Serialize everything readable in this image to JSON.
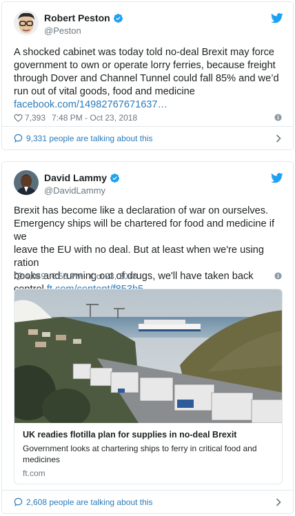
{
  "colors": {
    "link": "#2b7bb9",
    "muted": "#697882",
    "border": "#e1e8ed",
    "twitter_blue": "#1da1f2"
  },
  "tweets": [
    {
      "name": "Robert Peston",
      "handle": "@Peston",
      "text_lines": [
        "A shocked cabinet was today told no-deal Brexit may force",
        "government to own or operate lorry ferries, because freight",
        "through Dover and Channel Tunnel could fall 85% and we’d",
        "run out of vital goods, food and medicine"
      ],
      "link": "facebook.com/14982767671637…",
      "likes": "7,393",
      "timestamp": "7:48 PM - Oct 23, 2018",
      "talking": "9,331 people are talking about this",
      "icons": {
        "verified": "verified-badge-icon",
        "bird": "twitter-bird-icon",
        "heart": "heart-icon",
        "info": "info-icon",
        "bubble": "speech-bubble-icon",
        "chevron": "chevron-right-icon"
      }
    },
    {
      "name": "David Lammy",
      "handle": "@DavidLammy",
      "text_lines": [
        "Brexit has become like a declaration of war on ourselves.",
        "Emergency ships will be chartered for food and medicine if we",
        "leave the EU with no deal. But at least when we're using ration",
        "books and running out of drugs, we'll have taken back"
      ],
      "last_line_text": "control.",
      "link": "ft.com/content/f853b5…",
      "likes": "4,049",
      "timestamp": "6:53 PM - Oct 23, 2018",
      "card": {
        "title": "UK readies flotilla plan for supplies in no-deal Brexit",
        "description": "Government looks at chartering ships to ferry in critical food and medicines",
        "domain": "ft.com"
      },
      "talking": "2,608 people are talking about this"
    }
  ]
}
